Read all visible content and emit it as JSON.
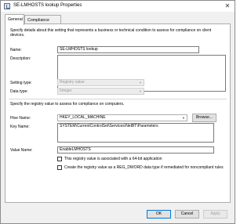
{
  "window": {
    "title": "SE-LMHOSTS lookup Properties",
    "close_glyph": "✕"
  },
  "tabs": [
    {
      "label": "General"
    },
    {
      "label": "Compliance Rules"
    }
  ],
  "general": {
    "intro": "Specify details about this setting that represents a business or technical condition to assess for compliance on client devices.",
    "name_label": "Name:",
    "name_value": "SE-LMHOSTS lookup",
    "description_label": "Description:",
    "description_value": "",
    "setting_type_label": "Setting type:",
    "setting_type_value": "Registry value",
    "data_type_label": "Data type:",
    "data_type_value": "Integer"
  },
  "registry": {
    "intro": "Specify the registry value to assess for compliance on computers.",
    "hive_label": "Hive Name:",
    "hive_value": "HKEY_LOCAL_MACHINE",
    "browse_label": "Browse...",
    "key_label": "Key Name:",
    "key_value": "SYSTEM\\CurrentControlSet\\Services\\NetBT\\Parameters",
    "value_label": "Value Name:",
    "value_value": "EnableLMHOSTS",
    "check64_label": "This registry value is associated with a 64-bit application",
    "check64_checked": false,
    "checkcreate_label": "Create the registry value as a REG_DWORD data type if remediated for noncompliant rules",
    "checkcreate_checked": false
  },
  "footer": {
    "ok_label": "OK",
    "cancel_label": "Cancel",
    "apply_label": "Apply"
  },
  "colors": {
    "default_button_border": "#0078d7",
    "disabled_text": "#a0a0a0"
  }
}
